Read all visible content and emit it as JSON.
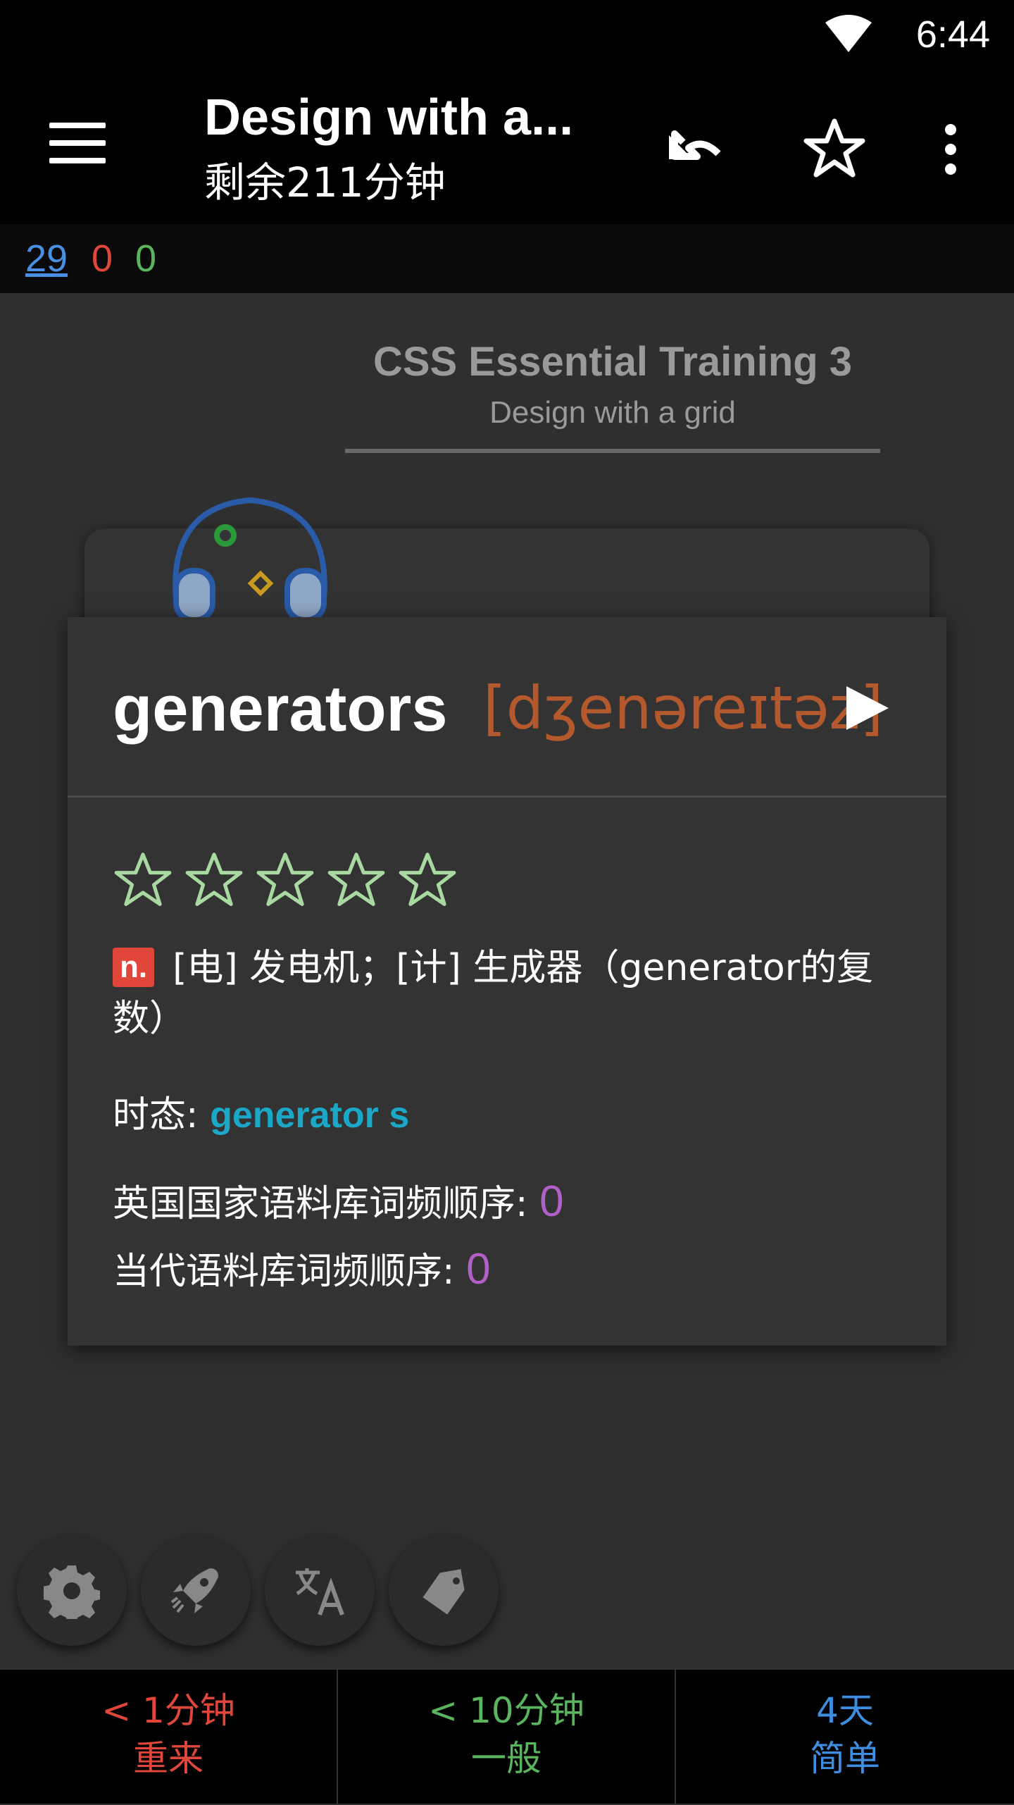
{
  "status_bar": {
    "time": "6:44"
  },
  "app_bar": {
    "title": "Design with a...",
    "subtitle": "剩余211分钟"
  },
  "counts": {
    "new": "29",
    "learning": "0",
    "review": "0"
  },
  "card": {
    "deck_title": "CSS Essential Training 3",
    "deck_subtitle": "Design with a grid"
  },
  "dictionary": {
    "word": "generators",
    "phonetic": "[dʒenəreɪtəz]",
    "rating_stars": 0,
    "rating_max": 5,
    "pos": "n.",
    "definition": "[电] 发电机；[计] 生成器（generator的复数）",
    "tense_label": "时态: ",
    "tense_forms": "generator  s",
    "bnc_label": "英国国家语料库词频顺序: ",
    "bnc_value": "0",
    "coca_label": "当代语料库词频顺序: ",
    "coca_value": "0"
  },
  "fab_icons": [
    "gear-icon",
    "rocket-icon",
    "translate-icon",
    "tag-icon"
  ],
  "answers": [
    {
      "interval": "< 1分钟",
      "label": "重来"
    },
    {
      "interval": "< 10分钟",
      "label": "一般"
    },
    {
      "interval": "4天",
      "label": "简单"
    }
  ],
  "colors": {
    "again": "#e0473a",
    "good": "#5ab55e",
    "easy": "#3d8de0",
    "phonetic": "#b4582d",
    "tense": "#1ba8c8",
    "freq": "#b160c8"
  }
}
